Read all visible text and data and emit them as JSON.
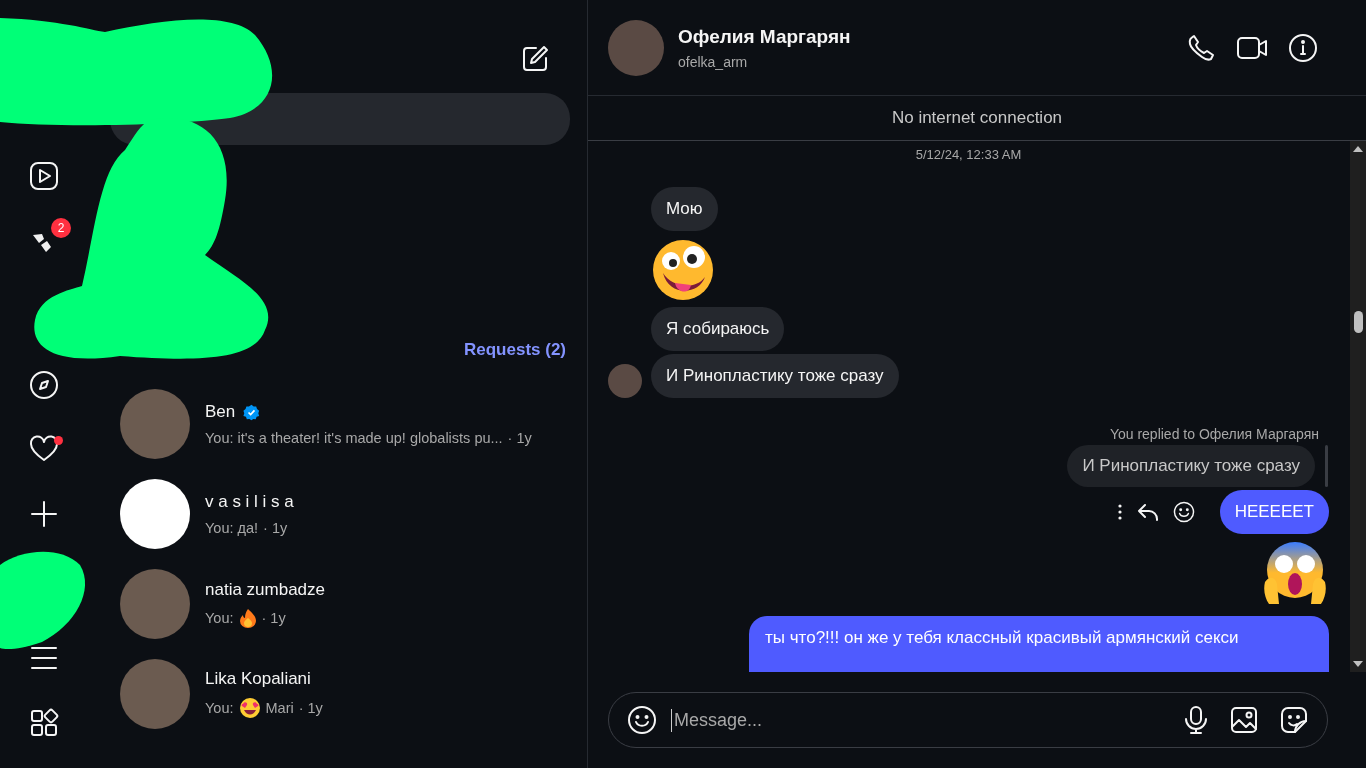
{
  "rail": {
    "items": [
      {
        "dot": false
      },
      {
        "badge": "2",
        "dot": false
      },
      {
        "dot": false
      },
      {
        "dot": true
      },
      {
        "dot": false
      },
      {
        "dot": false
      },
      {
        "dot": false
      }
    ]
  },
  "inbox": {
    "requests": "Requests (2)",
    "conversations": [
      {
        "kind": "photo",
        "name": "Ben",
        "verified": true,
        "preview": [
          {
            "kind": "text",
            "text": "You: it's a theater! it's made up! globalists pu..."
          }
        ],
        "time": "· 1y"
      },
      {
        "kind": "drawing",
        "name": "v a s i l i s a",
        "verified": false,
        "preview": [
          {
            "kind": "text",
            "text": "You: да!"
          }
        ],
        "time": "· 1y"
      },
      {
        "kind": "photo",
        "name": "natia zumbadze",
        "verified": false,
        "preview": [
          {
            "kind": "text",
            "text": "You:"
          },
          {
            "kind": "fire"
          }
        ],
        "time": "· 1y"
      },
      {
        "kind": "photo",
        "name": "Lika Kopaliani",
        "verified": false,
        "preview": [
          {
            "kind": "text",
            "text": "You:"
          },
          {
            "kind": "heart-eyes"
          },
          {
            "kind": "text",
            "text": "Mari"
          }
        ],
        "time": "· 1y"
      }
    ]
  },
  "chat": {
    "name": "Офелия Маргарян",
    "username": "ofelka_arm",
    "banner": "No internet connection",
    "messages": [
      {
        "kind": "timestamp",
        "text": "5/12/24, 12:33 AM"
      },
      {
        "kind": "received",
        "text": "Мою",
        "avatar": false
      },
      {
        "kind": "zany",
        "avatar": false
      },
      {
        "kind": "received",
        "text": "Я собираюсь",
        "avatar": false
      },
      {
        "kind": "received",
        "text": "И Ринопластику тоже сразу",
        "avatar": true
      },
      {
        "kind": "reply",
        "label": "You replied to Офелия Маргарян",
        "quote": "И Ринопластику тоже сразу"
      },
      {
        "kind": "sent",
        "text": "НЕЕЕЕЕТ",
        "actions": true
      },
      {
        "kind": "scream"
      },
      {
        "kind": "sent",
        "text": "ты что?!!! он же у тебя классный красивый армянский секси"
      }
    ],
    "composer": {
      "placeholder": "Message..."
    }
  }
}
